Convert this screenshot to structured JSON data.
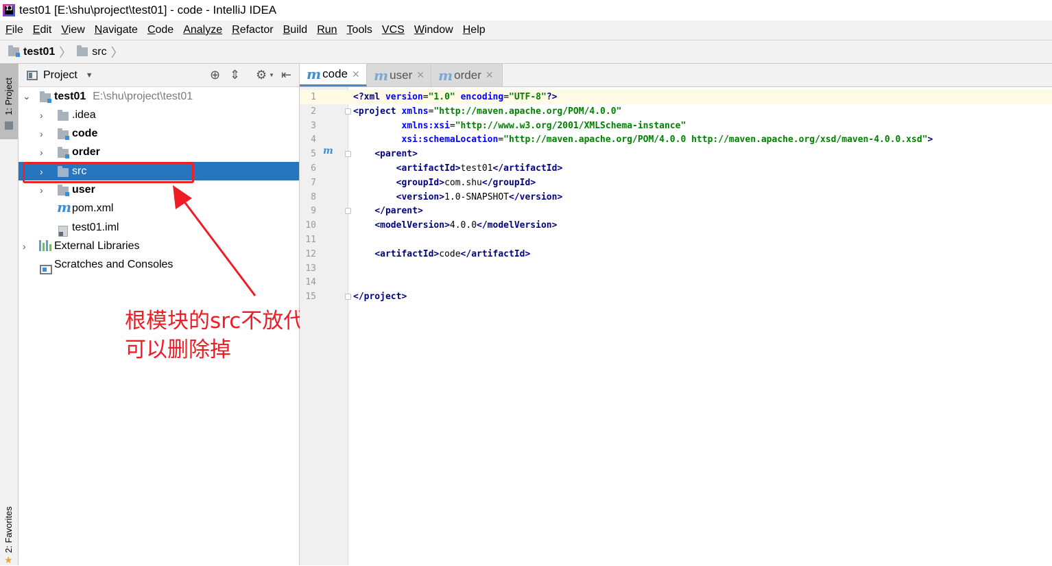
{
  "window": {
    "title": "test01 [E:\\shu\\project\\test01] - code - IntelliJ IDEA"
  },
  "menu": [
    {
      "label": "File",
      "mnemonic": "F",
      "rest": "ile"
    },
    {
      "label": "Edit",
      "mnemonic": "E",
      "rest": "dit"
    },
    {
      "label": "View",
      "mnemonic": "V",
      "rest": "iew"
    },
    {
      "label": "Navigate",
      "mnemonic": "N",
      "rest": "avigate"
    },
    {
      "label": "Code",
      "mnemonic": "C",
      "rest": "ode"
    },
    {
      "label": "Analyze",
      "mnemonic": "",
      "rest": "Analyze"
    },
    {
      "label": "Refactor",
      "mnemonic": "R",
      "rest": "efactor"
    },
    {
      "label": "Build",
      "mnemonic": "B",
      "rest": "uild"
    },
    {
      "label": "Run",
      "mnemonic": "",
      "rest": "Run"
    },
    {
      "label": "Tools",
      "mnemonic": "T",
      "rest": "ools"
    },
    {
      "label": "VCS",
      "mnemonic": "",
      "rest": "VCS"
    },
    {
      "label": "Window",
      "mnemonic": "W",
      "rest": "indow"
    },
    {
      "label": "Help",
      "mnemonic": "H",
      "rest": "elp"
    }
  ],
  "breadcrumb": {
    "root": "test01",
    "child": "src"
  },
  "toolstrip": {
    "project_tab": "1: Project",
    "favorites_tab": "2: Favorites"
  },
  "project_panel": {
    "title": "Project",
    "tree": [
      {
        "label": "test01",
        "hint": "E:\\shu\\project\\test01",
        "kind": "module-folder",
        "expanded": true
      },
      {
        "label": ".idea",
        "kind": "folder"
      },
      {
        "label": "code",
        "kind": "module-folder"
      },
      {
        "label": "order",
        "kind": "module-folder"
      },
      {
        "label": "src",
        "kind": "folder",
        "selected": true
      },
      {
        "label": "user",
        "kind": "module-folder"
      },
      {
        "label": "pom.xml",
        "kind": "maven-file"
      },
      {
        "label": "test01.iml",
        "kind": "iml-file"
      },
      {
        "label": "External Libraries",
        "kind": "libraries"
      },
      {
        "label": "Scratches and Consoles",
        "kind": "scratches"
      }
    ]
  },
  "annotation": {
    "line1": "根模块的src不放代码,",
    "line2": "可以删除掉",
    "color": "#ee1c24"
  },
  "tabs": [
    {
      "label": "code",
      "active": true
    },
    {
      "label": "user",
      "active": false
    },
    {
      "label": "order",
      "active": false
    }
  ],
  "editor": {
    "line_numbers": [
      "1",
      "2",
      "3",
      "4",
      "5",
      "6",
      "7",
      "8",
      "9",
      "10",
      "11",
      "12",
      "13",
      "14",
      "15"
    ],
    "lines": [
      "<?xml version=\"1.0\" encoding=\"UTF-8\"?>",
      "<project xmlns=\"http://maven.apache.org/POM/4.0.0\"",
      "         xmlns:xsi=\"http://www.w3.org/2001/XMLSchema-instance\"",
      "         xsi:schemaLocation=\"http://maven.apache.org/POM/4.0.0 http://maven.apache.org/xsd/maven-4.0.0.xsd\">",
      "    <parent>",
      "        <artifactId>test01</artifactId>",
      "        <groupId>com.shu</groupId>",
      "        <version>1.0-SNAPSHOT</version>",
      "    </parent>",
      "    <modelVersion>4.0.0</modelVersion>",
      "",
      "    <artifactId>code</artifactId>",
      "",
      "",
      "</project>"
    ]
  }
}
